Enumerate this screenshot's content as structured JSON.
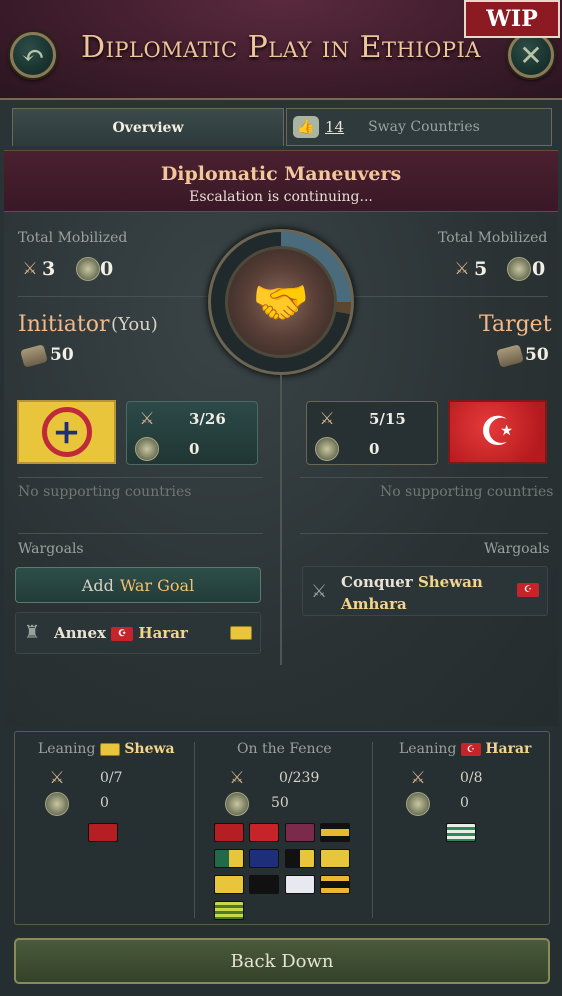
{
  "header": {
    "title": "Diplomatic Play in Ethiopia",
    "wip_label": "WIP"
  },
  "tabs": {
    "overview": "Overview",
    "sway_count": "14",
    "sway": "Sway Countries"
  },
  "maneuvers": {
    "title": "Diplomatic Maneuvers",
    "subtitle": "Escalation is continuing..."
  },
  "initiator": {
    "mobilized_label": "Total Mobilized",
    "mobilized_troops": "3",
    "mobilized_generals": "0",
    "role": "Initiator",
    "you": "(You)",
    "money": "50",
    "troops": "3/26",
    "generals": "0",
    "supporting": "No supporting countries",
    "wargoals_label": "Wargoals",
    "add_war_prefix": "Add",
    "add_war_highlight": "War Goal",
    "wargoal_action": "Annex",
    "wargoal_target": "Harar"
  },
  "target": {
    "mobilized_label": "Total Mobilized",
    "mobilized_troops": "5",
    "mobilized_generals": "0",
    "role": "Target",
    "money": "50",
    "troops": "5/15",
    "generals": "0",
    "supporting": "No supporting countries",
    "wargoals_label": "Wargoals",
    "wargoal_action": "Conquer",
    "wargoal_target_1": "Shewan",
    "wargoal_target_2": "Amhara"
  },
  "leaning": {
    "left": {
      "label": "Leaning",
      "country": "Shewa",
      "troops": "0/7",
      "generals": "0"
    },
    "middle": {
      "label": "On the Fence",
      "troops": "0/239",
      "generals": "50"
    },
    "right": {
      "label": "Leaning",
      "country": "Harar",
      "troops": "0/8",
      "generals": "0"
    }
  },
  "back_down": "Back Down",
  "colors": {
    "accent": "#f3b98a",
    "title": "#f0c49a",
    "highlight": "#f2d58a"
  }
}
